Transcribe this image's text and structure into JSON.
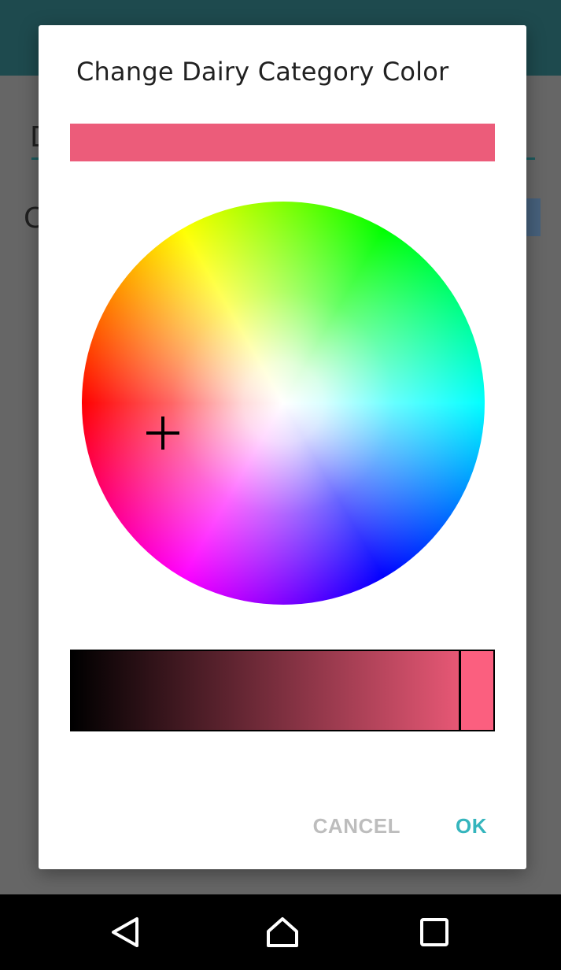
{
  "dialog": {
    "title": "Change Dairy Category Color",
    "selected_color": "#ec5c7a",
    "value_slider": {
      "level": 0.92,
      "end_color": "#fb5f7f"
    },
    "buttons": {
      "cancel": "CANCEL",
      "ok": "OK"
    }
  },
  "background": {
    "toolbar_color": "#1e4a4e",
    "text_fragment_1": "D",
    "text_fragment_2": "C"
  },
  "colors": {
    "accent": "#35b5bd",
    "cancel_text": "#bdbdbd"
  },
  "navigation": {
    "back_icon": "back-triangle-icon",
    "home_icon": "home-icon",
    "recent_icon": "recent-apps-square-icon"
  }
}
